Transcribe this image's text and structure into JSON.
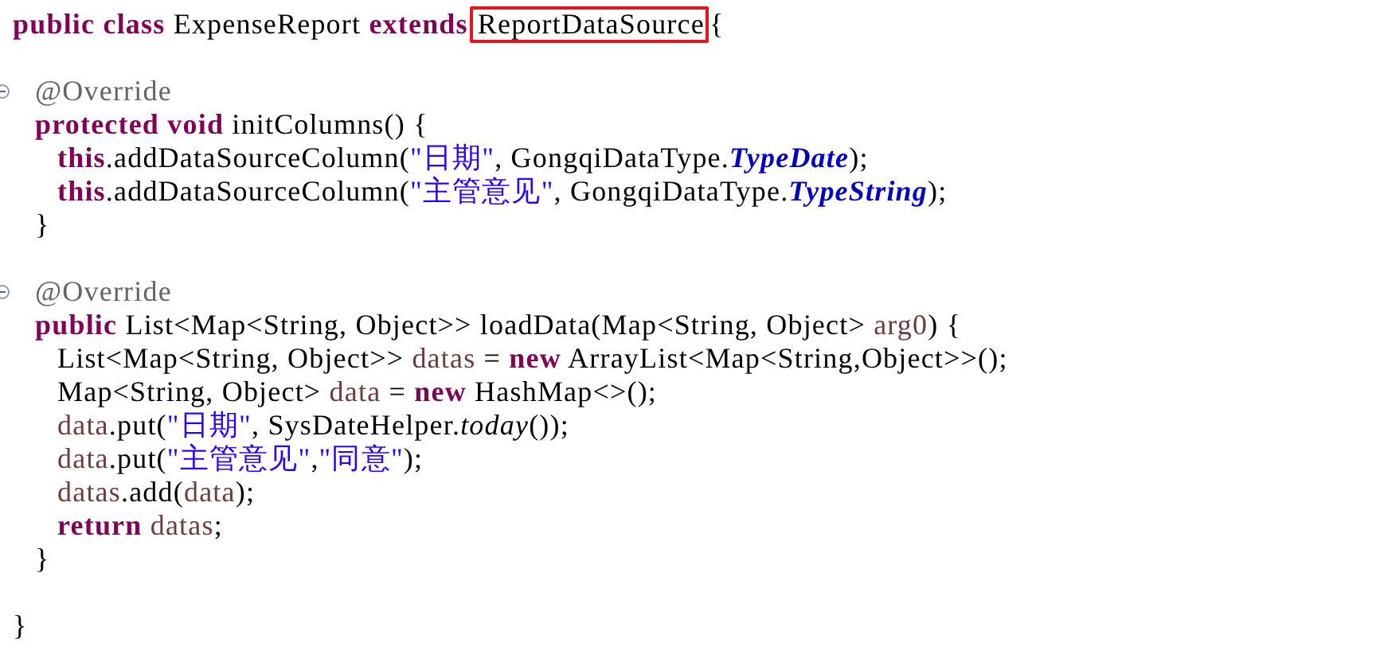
{
  "lines": [
    {
      "tokens": [
        {
          "kind": "keyword",
          "text": "public class"
        },
        {
          "kind": "plain",
          "text": " ExpenseReport "
        },
        {
          "kind": "keyword",
          "text": "extends"
        },
        {
          "kind": "plain",
          "text": "ReportDataSource",
          "boxed": true
        },
        {
          "kind": "plain",
          "text": "{"
        }
      ],
      "children": [
        {
          "kind": "blank"
        },
        {
          "expanded": true,
          "tokens": [
            {
              "kind": "annotation",
              "text": "@Override"
            }
          ]
        },
        {
          "tokens": [
            {
              "kind": "keyword",
              "text": "protected void"
            },
            {
              "kind": "plain",
              "text": " initColumns() {"
            }
          ],
          "children": [
            {
              "tokens": [
                {
                  "kind": "keyword",
                  "text": "this"
                },
                {
                  "kind": "plain",
                  "text": ".addDataSourceColumn("
                },
                {
                  "kind": "string",
                  "text": "\"日期\""
                },
                {
                  "kind": "plain",
                  "text": ", GongqiDataType."
                },
                {
                  "kind": "constant",
                  "text": "TypeDate"
                },
                {
                  "kind": "plain",
                  "text": ");"
                }
              ]
            },
            {
              "tokens": [
                {
                  "kind": "keyword",
                  "text": "this"
                },
                {
                  "kind": "plain",
                  "text": ".addDataSourceColumn("
                },
                {
                  "kind": "string",
                  "text": "\"主管意见\""
                },
                {
                  "kind": "plain",
                  "text": ", GongqiDataType."
                },
                {
                  "kind": "constant",
                  "text": "TypeString"
                },
                {
                  "kind": "plain",
                  "text": ");"
                }
              ]
            }
          ]
        },
        {
          "tokens": [
            {
              "kind": "plain",
              "text": "}"
            }
          ]
        },
        {
          "kind": "blank"
        },
        {
          "expanded": true,
          "tokens": [
            {
              "kind": "annotation",
              "text": "@Override"
            }
          ]
        },
        {
          "tokens": [
            {
              "kind": "keyword",
              "text": "public"
            },
            {
              "kind": "plain",
              "text": " List<Map<String, Object>> loadData(Map<String, Object> "
            },
            {
              "kind": "variable",
              "text": "arg0"
            },
            {
              "kind": "plain",
              "text": ") {"
            }
          ],
          "children": [
            {
              "tokens": [
                {
                  "kind": "plain",
                  "text": "List<Map<String, Object>> "
                },
                {
                  "kind": "variable",
                  "text": "datas"
                },
                {
                  "kind": "plain",
                  "text": " = "
                },
                {
                  "kind": "keyword",
                  "text": "new"
                },
                {
                  "kind": "plain",
                  "text": " ArrayList<Map<String,Object>>();"
                }
              ]
            },
            {
              "tokens": [
                {
                  "kind": "plain",
                  "text": "Map<String, Object> "
                },
                {
                  "kind": "variable",
                  "text": "data"
                },
                {
                  "kind": "plain",
                  "text": " = "
                },
                {
                  "kind": "keyword",
                  "text": "new"
                },
                {
                  "kind": "plain",
                  "text": " HashMap<>();"
                }
              ]
            },
            {
              "tokens": [
                {
                  "kind": "variable",
                  "text": "data"
                },
                {
                  "kind": "plain",
                  "text": ".put("
                },
                {
                  "kind": "string",
                  "text": "\"日期\""
                },
                {
                  "kind": "plain",
                  "text": ", SysDateHelper."
                },
                {
                  "kind": "static",
                  "text": "today"
                },
                {
                  "kind": "plain",
                  "text": "());"
                }
              ]
            },
            {
              "tokens": [
                {
                  "kind": "variable",
                  "text": "data"
                },
                {
                  "kind": "plain",
                  "text": ".put("
                },
                {
                  "kind": "string",
                  "text": "\"主管意见\""
                },
                {
                  "kind": "plain",
                  "text": ","
                },
                {
                  "kind": "string",
                  "text": "\"同意\""
                },
                {
                  "kind": "plain",
                  "text": ");"
                }
              ]
            },
            {
              "tokens": [
                {
                  "kind": "variable",
                  "text": "datas"
                },
                {
                  "kind": "plain",
                  "text": ".add("
                },
                {
                  "kind": "variable",
                  "text": "data"
                },
                {
                  "kind": "plain",
                  "text": ");"
                }
              ]
            },
            {
              "tokens": [
                {
                  "kind": "keyword",
                  "text": "return"
                },
                {
                  "kind": "variable",
                  "text": " datas"
                },
                {
                  "kind": "plain",
                  "text": ";"
                }
              ]
            }
          ]
        },
        {
          "tokens": [
            {
              "kind": "plain",
              "text": "}"
            }
          ]
        },
        {
          "kind": "blank"
        }
      ]
    },
    {
      "tokens": [
        {
          "kind": "plain",
          "text": "}"
        }
      ]
    }
  ]
}
